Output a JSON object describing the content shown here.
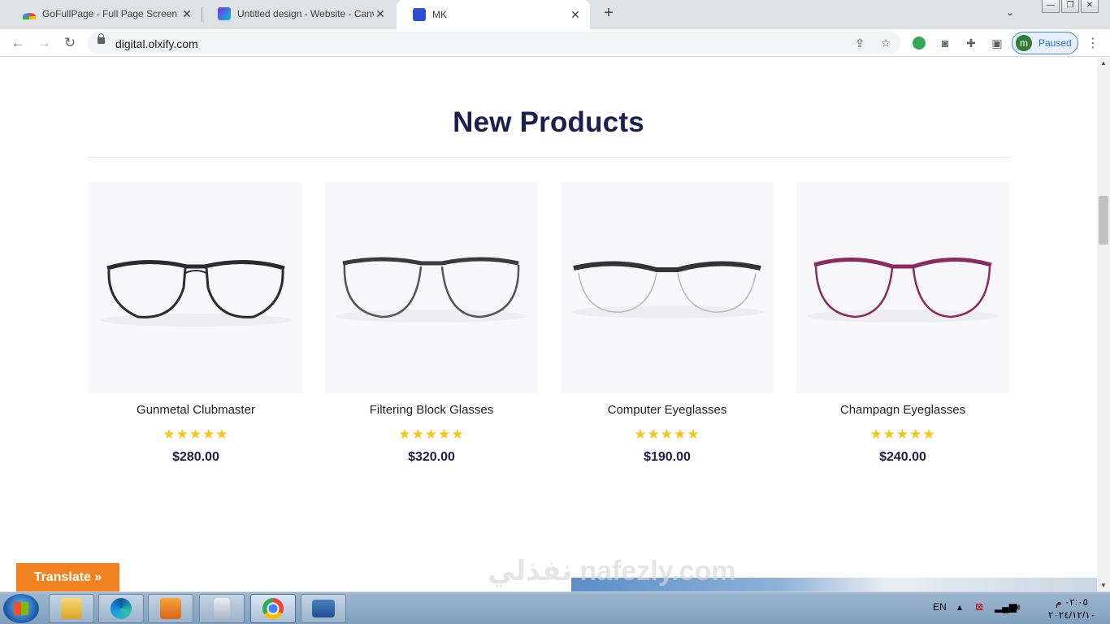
{
  "browser": {
    "tabs": [
      {
        "title": "GoFullPage - Full Page Screen Ca",
        "active": false,
        "favicon": "gofullpage-icon",
        "color": "#e8453c"
      },
      {
        "title": "Untitled design - Website - Canv",
        "active": false,
        "favicon": "canva-icon",
        "color": "#7d2ae8"
      },
      {
        "title": "MK",
        "active": true,
        "favicon": "mk-site-icon",
        "color": "#2a4fd1"
      }
    ],
    "new_tab_label": "+",
    "url": "digital.olxify.com",
    "profile_initial": "m",
    "profile_status": "Paused",
    "window_controls": {
      "minimize": "—",
      "maximize": "❐",
      "close": "✕"
    }
  },
  "page": {
    "section_title": "New Products",
    "products": [
      {
        "name": "Gunmetal Clubmaster",
        "rating": 5,
        "stars": "★★★★★",
        "price": "$280.00",
        "frame_color": "#2b2b2b",
        "style": "round-top"
      },
      {
        "name": "Filtering Block Glasses",
        "rating": 5,
        "stars": "★★★★★",
        "price": "$320.00",
        "frame_color": "#3a3a3a",
        "style": "cat"
      },
      {
        "name": "Computer Eyeglasses",
        "rating": 5,
        "stars": "★★★★★",
        "price": "$190.00",
        "frame_color": "#333333",
        "style": "half-rim"
      },
      {
        "name": "Champagn Eyeglasses",
        "rating": 5,
        "stars": "★★★★★",
        "price": "$240.00",
        "frame_color": "#8a2a5e",
        "style": "cat"
      }
    ],
    "translate_label": "Translate »",
    "watermark_text": "نفذلي nafezly.com"
  },
  "taskbar": {
    "language": "EN",
    "clock_time": "٠٢:٠٥ م",
    "clock_date": "٢٠٢٤/١٢/١٠",
    "apps": [
      "file-explorer-icon",
      "edge-icon",
      "media-player-icon",
      "calculator-icon",
      "chrome-icon",
      "remote-desktop-icon"
    ]
  },
  "colors": {
    "heading": "#1a1f4e",
    "stars": "#f5c518",
    "translate_button": "#f0831f"
  }
}
